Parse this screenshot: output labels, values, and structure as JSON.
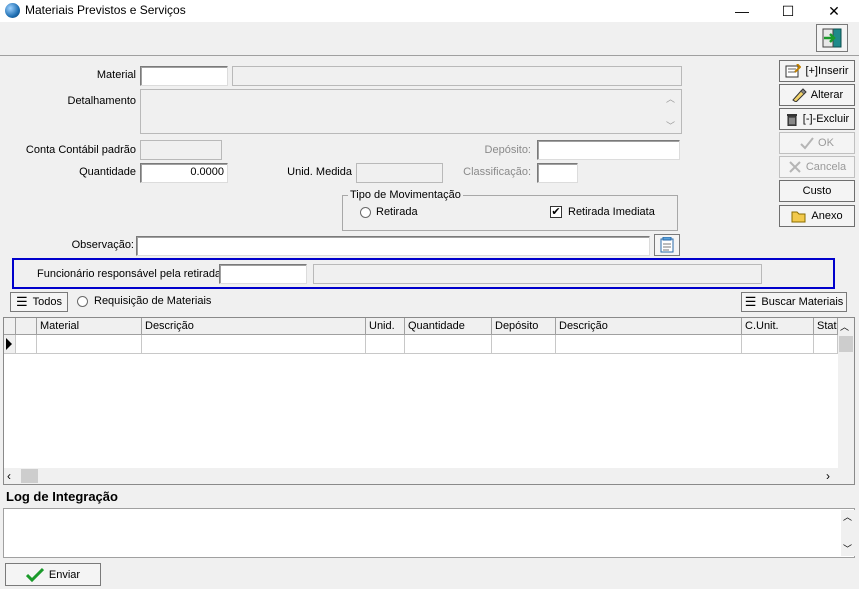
{
  "window": {
    "title": "Materiais Previstos e Serviços",
    "minimize": "—",
    "maximize": "☐",
    "close": "✕"
  },
  "form": {
    "material_label": "Material",
    "material_code": "",
    "material_desc": "",
    "detalhamento_label": "Detalhamento",
    "detalhamento_value": "",
    "conta_label": "Conta Contábil padrão",
    "conta_value": "",
    "deposito_label": "Depósito:",
    "deposito_value": "",
    "quantidade_label": "Quantidade",
    "quantidade_value": "0.0000",
    "unid_label": "Unid. Medida",
    "unid_value": "",
    "classificacao_label": "Classificação:",
    "classificacao_value": "",
    "tipo_label": "Tipo de Movimentação",
    "retirada_label": "Retirada",
    "retirada_imediata_label": "Retirada Imediata",
    "retirada_imediata_checked": "✔",
    "observacao_label": "Observação:",
    "observacao_value": "",
    "funcionario_label": "Funcionário responsável pela retirada",
    "funcionario_code": "",
    "funcionario_name": ""
  },
  "side_buttons": {
    "inserir": "[+]Inserir",
    "alterar": "Alterar",
    "excluir": "[-]-Excluir",
    "ok": "OK",
    "cancela": "Cancela",
    "custo": "Custo",
    "anexo": "Anexo"
  },
  "filter": {
    "todos_label": "Todos",
    "requisicao_label": "Requisição de Materiais",
    "buscar_label": "Buscar Materiais"
  },
  "grid": {
    "columns": [
      "Material",
      "Descrição",
      "Unid.",
      "Quantidade",
      "Depósito",
      "Descrição",
      "C.Unit.",
      "Stat"
    ]
  },
  "log": {
    "title": "Log de Integração",
    "value": ""
  },
  "footer": {
    "enviar_label": "Enviar"
  },
  "colors": {
    "highlight_border": "#0000cc",
    "ok_green": "#1a9a2a"
  }
}
